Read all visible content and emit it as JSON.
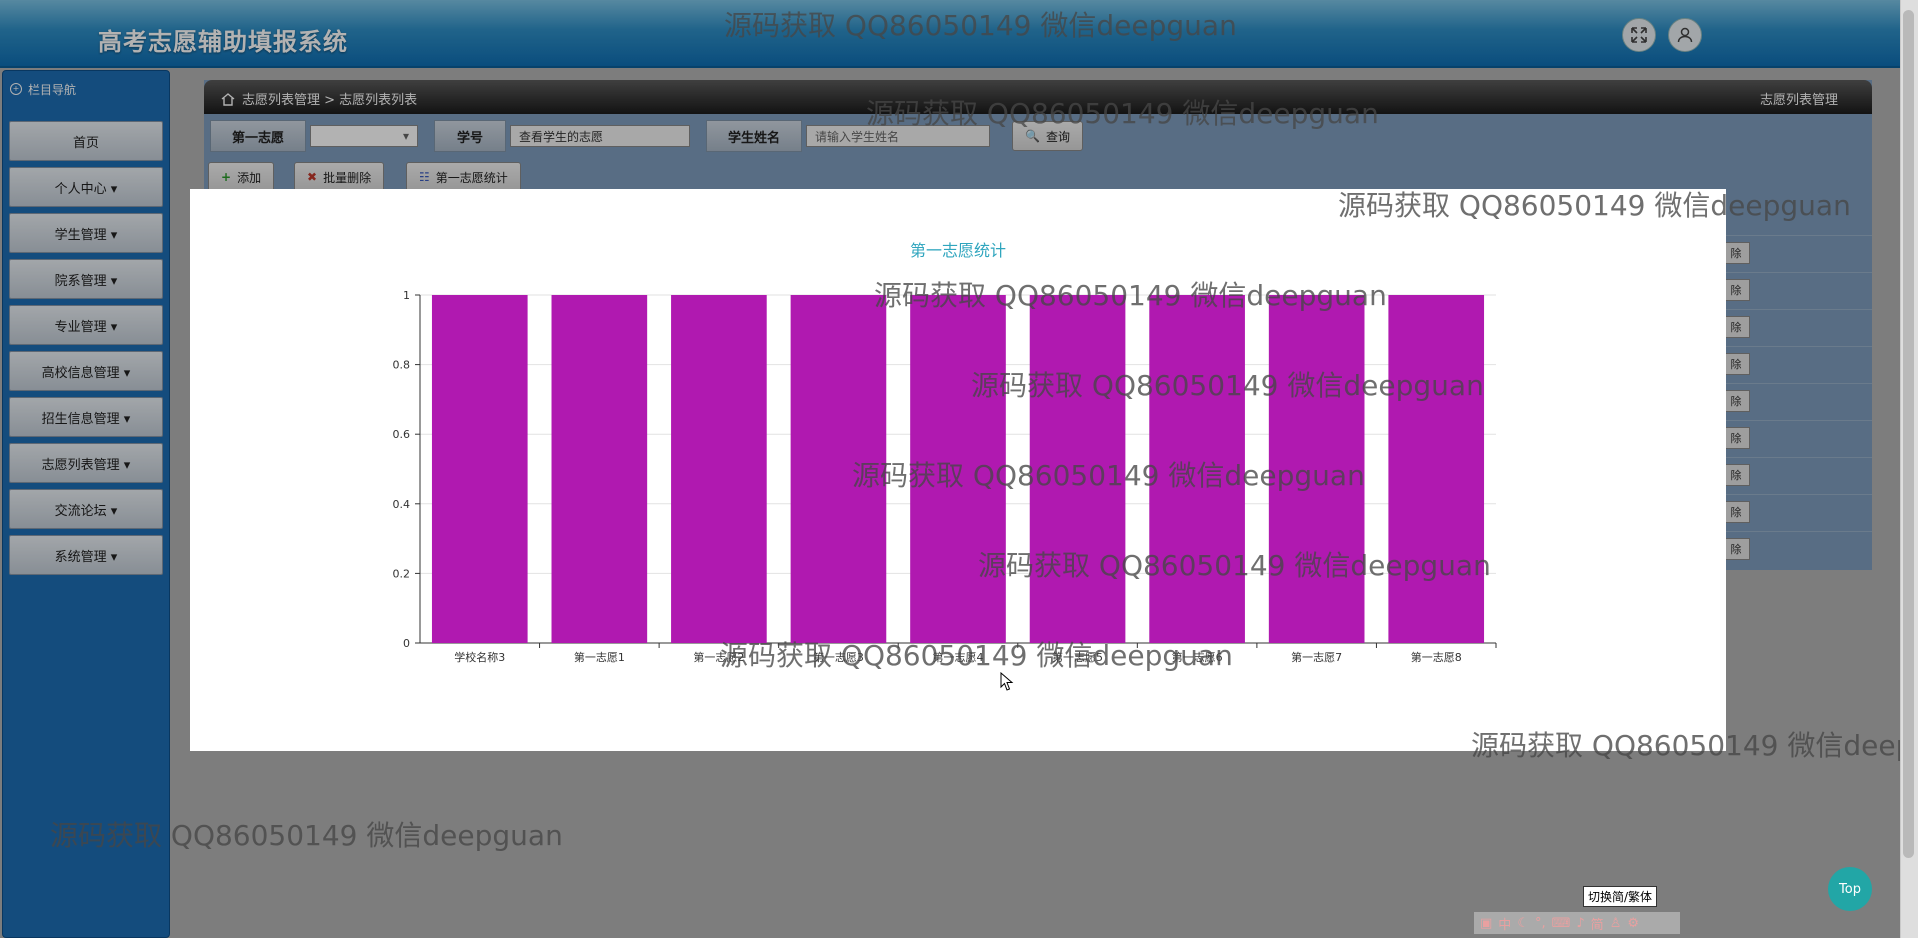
{
  "app": {
    "title": "高考志愿辅助填报系统"
  },
  "sidebar": {
    "header": "栏目导航",
    "items": [
      {
        "label": "首页"
      },
      {
        "label": "个人中心 ▾"
      },
      {
        "label": "学生管理 ▾"
      },
      {
        "label": "院系管理 ▾"
      },
      {
        "label": "专业管理 ▾"
      },
      {
        "label": "高校信息管理 ▾"
      },
      {
        "label": "招生信息管理 ▾"
      },
      {
        "label": "志愿列表管理 ▾"
      },
      {
        "label": "交流论坛 ▾"
      },
      {
        "label": "系统管理 ▾"
      }
    ]
  },
  "breadcrumb": {
    "path": "志愿列表管理 > 志愿列表列表",
    "right": "志愿列表管理"
  },
  "search": {
    "first_choice_label": "第一志愿",
    "student_no_label": "学号",
    "student_no_value": "查看学生的志愿",
    "student_name_label": "学生姓名",
    "student_name_placeholder": "请输入学生姓名",
    "query_button": "查询"
  },
  "toolbar": {
    "add": "添加",
    "batch_delete": "批量删除",
    "stats": "第一志愿统计"
  },
  "table": {
    "row_action_label": "除",
    "row_count": 9
  },
  "chart_data": {
    "type": "bar",
    "title": "第一志愿统计",
    "categories": [
      "学校名称3",
      "第一志愿1",
      "第一志愿2",
      "第一志愿3",
      "第一志愿4",
      "第一志愿5",
      "第一志愿6",
      "第一志愿7",
      "第一志愿8"
    ],
    "values": [
      1,
      1,
      1,
      1,
      1,
      1,
      1,
      1,
      1
    ],
    "ylim": [
      0,
      1
    ],
    "yticks": [
      "0",
      "0.2",
      "0.4",
      "0.6",
      "0.8",
      "1"
    ],
    "bar_color": "#b019b0",
    "grid": true,
    "xlabel": "",
    "ylabel": ""
  },
  "watermark": {
    "text": "源码获取 QQ86050149 微信deepguan"
  },
  "widgets": {
    "lang_toggle": "切换简/繁体",
    "top_button": "Top"
  }
}
